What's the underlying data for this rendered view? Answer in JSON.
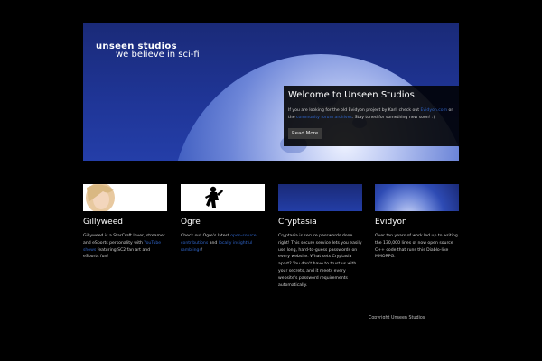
{
  "brand": {
    "name": "unseen studios",
    "tagline": "we believe in sci-fi"
  },
  "welcome": {
    "title": "Welcome to Unseen Studios",
    "text_before": "If you are looking for the old Evidyon project by Karl, check out ",
    "link1": "Evidyon.com",
    "text_mid": " or the ",
    "link2": "community forum archives",
    "text_after": ". Stay tuned for something new soon! :)",
    "button": "Read More"
  },
  "cards": [
    {
      "title": "Gillyweed",
      "text_before": "Gillyweed is a StarCraft lover, streamer and eSports personality with ",
      "link1": "YouTube shows",
      "text_after": " featuring SC2 fan art and eSports fun!"
    },
    {
      "title": "Ogre",
      "text_before": "Check out Ogre's latest ",
      "link1": "open-source contributions",
      "text_mid": " and ",
      "link2": "locally insightful ramblings",
      "text_after": "!"
    },
    {
      "title": "Cryptasia",
      "text": "Cryptasia is secure passwords done right! This secure service lets you easily use long, hard-to-guess passwords on every website. What sets Cryptasia apart? You don't have to trust us with your secrets, and it meets every website's password requirements automatically."
    },
    {
      "title": "Evidyon",
      "text": "Over ten years of work led up to writing the 130,000 lines of now open source C++ code that runs this Diablo-like MMORPG."
    }
  ],
  "footer": {
    "copyright": "Copyright Unseen Studios"
  },
  "colors": {
    "link": "#2f64c8",
    "background": "#000000",
    "hero": "#1f3596"
  }
}
